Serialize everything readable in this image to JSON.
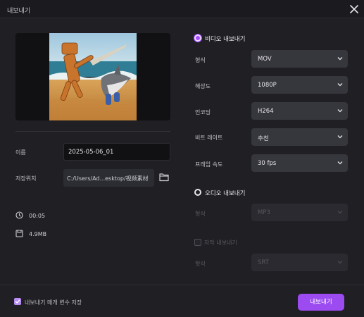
{
  "window": {
    "title": "내보내기"
  },
  "left": {
    "name_label": "이름",
    "name_value": "2025-05-06_01",
    "save_location_label": "저장위치",
    "save_location_value": "C:/Users/Ad...esktop/视频素材",
    "duration": "00:05",
    "file_size": "4.9MB"
  },
  "video_section": {
    "title": "비디오 내보내기",
    "selected": true,
    "fields": [
      {
        "label": "형식",
        "value": "MOV"
      },
      {
        "label": "해상도",
        "value": "1080P"
      },
      {
        "label": "인코딩",
        "value": "H264"
      },
      {
        "label": "비트 레이트",
        "value": "추천"
      },
      {
        "label": "프레임 속도",
        "value": "30  fps"
      }
    ]
  },
  "audio_section": {
    "title": "오디오 내보내기",
    "selected": false,
    "format_label": "형식",
    "format_value": "MP3"
  },
  "subtitle_section": {
    "title": "자막 내보내기",
    "checked": false,
    "format_label": "형식",
    "format_value": "SRT"
  },
  "footer": {
    "save_params_label": "내보내기 매개 변수 저장",
    "save_params_checked": true,
    "export_label": "내보내기"
  },
  "colors": {
    "accent": "#9c4bf1",
    "background": "#1f1f24"
  }
}
